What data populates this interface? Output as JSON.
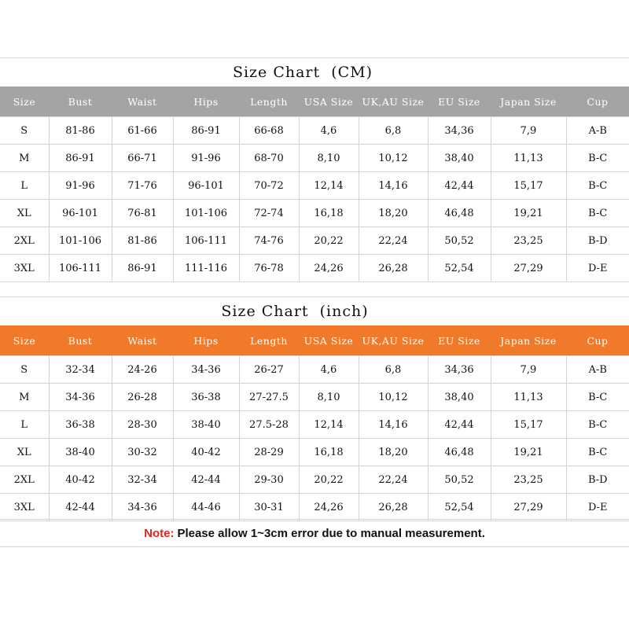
{
  "cm_chart": {
    "title": "Size Chart  (CM)",
    "headers": [
      "Size",
      "Bust",
      "Waist",
      "Hips",
      "Length",
      "USA Size",
      "UK,AU Size",
      "EU Size",
      "Japan Size",
      "Cup"
    ],
    "rows": [
      [
        "S",
        "81-86",
        "61-66",
        "86-91",
        "66-68",
        "4,6",
        "6,8",
        "34,36",
        "7,9",
        "A-B"
      ],
      [
        "M",
        "86-91",
        "66-71",
        "91-96",
        "68-70",
        "8,10",
        "10,12",
        "38,40",
        "11,13",
        "B-C"
      ],
      [
        "L",
        "91-96",
        "71-76",
        "96-101",
        "70-72",
        "12,14",
        "14,16",
        "42,44",
        "15,17",
        "B-C"
      ],
      [
        "XL",
        "96-101",
        "76-81",
        "101-106",
        "72-74",
        "16,18",
        "18,20",
        "46,48",
        "19,21",
        "B-C"
      ],
      [
        "2XL",
        "101-106",
        "81-86",
        "106-111",
        "74-76",
        "20,22",
        "22,24",
        "50,52",
        "23,25",
        "B-D"
      ],
      [
        "3XL",
        "106-111",
        "86-91",
        "111-116",
        "76-78",
        "24,26",
        "26,28",
        "52,54",
        "27,29",
        "D-E"
      ]
    ]
  },
  "inch_chart": {
    "title": "Size Chart  (inch)",
    "headers": [
      "Size",
      "Bust",
      "Waist",
      "Hips",
      "Length",
      "USA Size",
      "UK,AU Size",
      "EU Size",
      "Japan Size",
      "Cup"
    ],
    "rows": [
      [
        "S",
        "32-34",
        "24-26",
        "34-36",
        "26-27",
        "4,6",
        "6,8",
        "34,36",
        "7,9",
        "A-B"
      ],
      [
        "M",
        "34-36",
        "26-28",
        "36-38",
        "27-27.5",
        "8,10",
        "10,12",
        "38,40",
        "11,13",
        "B-C"
      ],
      [
        "L",
        "36-38",
        "28-30",
        "38-40",
        "27.5-28",
        "12,14",
        "14,16",
        "42,44",
        "15,17",
        "B-C"
      ],
      [
        "XL",
        "38-40",
        "30-32",
        "40-42",
        "28-29",
        "16,18",
        "18,20",
        "46,48",
        "19,21",
        "B-C"
      ],
      [
        "2XL",
        "40-42",
        "32-34",
        "42-44",
        "29-30",
        "20,22",
        "22,24",
        "50,52",
        "23,25",
        "B-D"
      ],
      [
        "3XL",
        "42-44",
        "34-36",
        "44-46",
        "30-31",
        "24,26",
        "26,28",
        "52,54",
        "27,29",
        "D-E"
      ]
    ]
  },
  "note": {
    "label": "Note:",
    "text": "Please allow 1~3cm error due to manual measurement."
  },
  "colors": {
    "cm_header_bg": "#a4a4a4",
    "inch_header_bg": "#f07a2a",
    "note_label": "#e8231c"
  }
}
